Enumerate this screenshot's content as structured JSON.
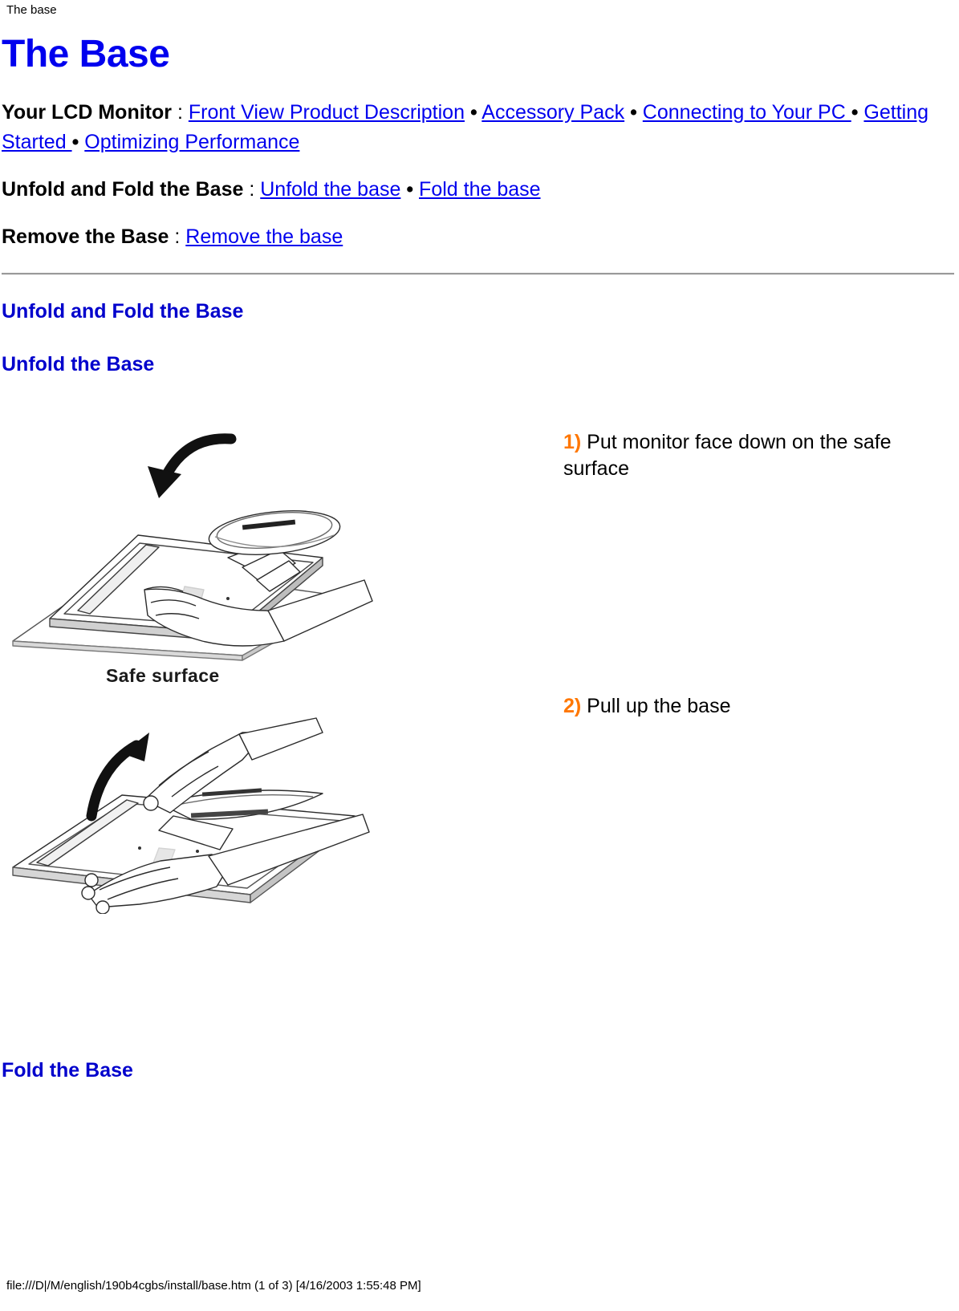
{
  "document": {
    "header_title": "The base",
    "page_title": "The Base",
    "footer": "file:///D|/M/english/190b4cgbs/install/base.htm (1 of 3) [4/16/2003 1:55:48 PM]"
  },
  "nav": {
    "groups": [
      {
        "lead": "Your LCD Monitor",
        "colon": " : ",
        "links": [
          "Front View Product Description",
          "Accessory Pack",
          "Connecting to Your PC ",
          "Getting Started ",
          "Optimizing Performance"
        ],
        "separator": "•"
      },
      {
        "lead": "Unfold and Fold the Base",
        "colon": " : ",
        "links": [
          "Unfold the base",
          "Fold the base"
        ],
        "separator": "•"
      },
      {
        "lead": "Remove the Base",
        "colon": " : ",
        "links": [
          "Remove the base"
        ],
        "separator": "•"
      }
    ]
  },
  "sections": {
    "unfold_and_fold_heading": "Unfold and Fold the Base",
    "unfold_heading": "Unfold the Base",
    "fold_heading": "Fold the Base"
  },
  "steps": [
    {
      "num": "1)",
      "text": " Put monitor face down on the safe surface"
    },
    {
      "num": "2)",
      "text": " Pull up the base"
    }
  ],
  "illustration": {
    "safe_surface_label": "Safe surface",
    "figure1_alt": "monitor-face-down-illustration",
    "figure2_alt": "pull-up-base-illustration"
  },
  "colors": {
    "link": "#0000ee",
    "heading": "#0000cc",
    "step_number": "#ff7700",
    "rule": "#9a9a9a",
    "text": "#000000"
  }
}
